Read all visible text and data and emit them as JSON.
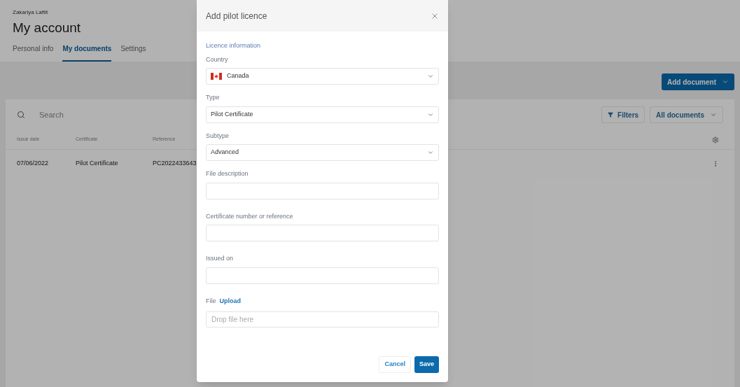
{
  "account": {
    "user": "Zakariya Laftit",
    "title": "My account"
  },
  "tabs": [
    {
      "label": "Personal info",
      "selected": false
    },
    {
      "label": "My documents",
      "selected": true
    },
    {
      "label": "Settings",
      "selected": false
    }
  ],
  "add_button": "Add document",
  "search": {
    "placeholder": "Search"
  },
  "filters_button": "Filters",
  "view_select": "All documents",
  "table": {
    "columns": [
      "Issue date",
      "Certificate",
      "Reference"
    ],
    "rows": [
      [
        "07/06/2022",
        "Pilot Certificate",
        "PC2022433643"
      ]
    ]
  },
  "dialog": {
    "title": "Add pilot licence",
    "section": "Licence information",
    "fields": [
      {
        "kind": "select",
        "label": "Country",
        "value": "Canada",
        "flag": true
      },
      {
        "kind": "select",
        "label": "Type",
        "value": "Pilot Certificate",
        "flag": false
      },
      {
        "kind": "select",
        "label": "Subtype",
        "value": "Advanced",
        "flag": false
      },
      {
        "kind": "text",
        "label": "File description"
      },
      {
        "kind": "text",
        "label": "Certificate number or reference"
      },
      {
        "kind": "text",
        "label": "Issued on"
      },
      {
        "kind": "file",
        "label": "File",
        "link": "Upload",
        "placeholder": "Drop file here"
      }
    ],
    "buttons": {
      "cancel": "Cancel",
      "save": "Save"
    }
  }
}
